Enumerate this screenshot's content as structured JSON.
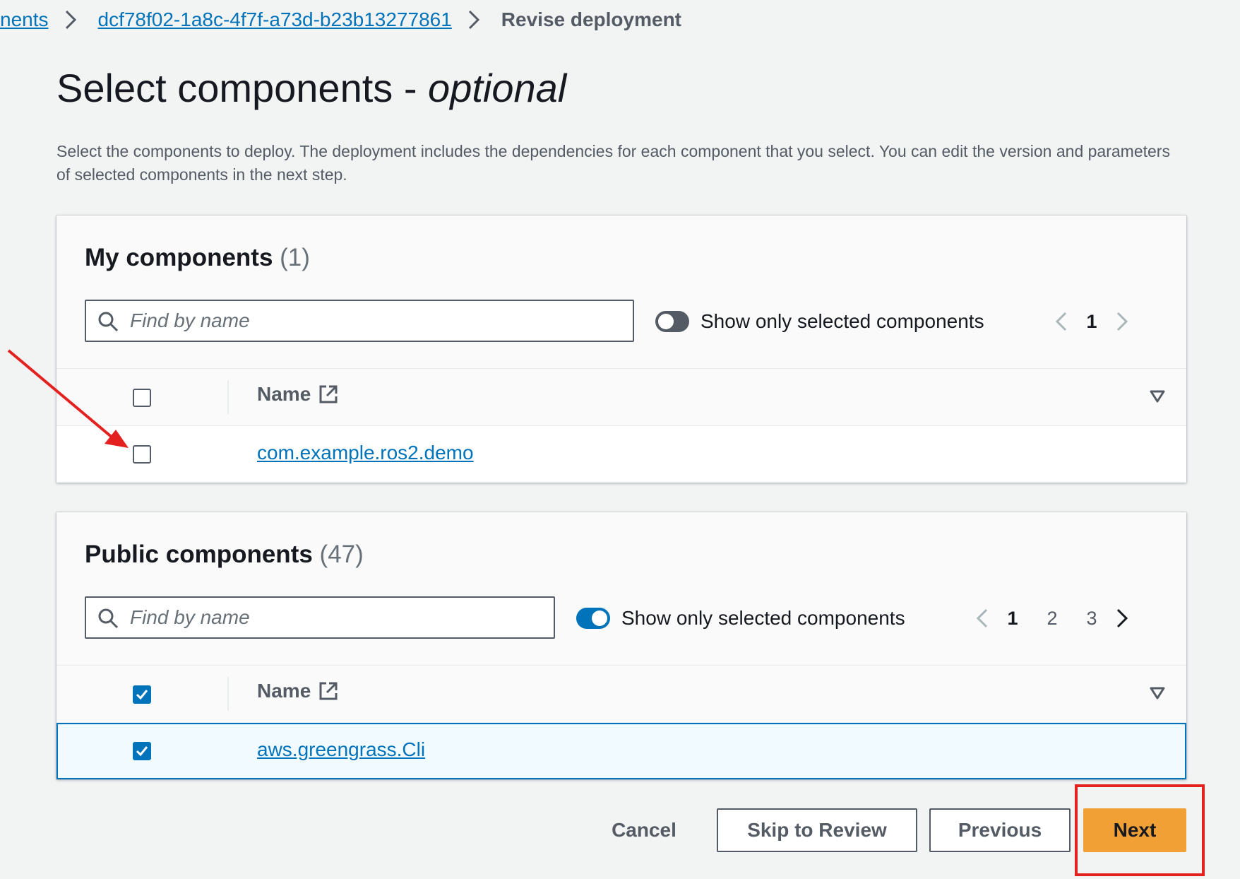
{
  "breadcrumb": {
    "items": [
      {
        "label": "nents"
      },
      {
        "label": "dcf78f02-1a8c-4f7f-a73d-b23b13277861"
      },
      {
        "label": "Revise deployment"
      }
    ]
  },
  "page": {
    "title": "Select components - ",
    "title_italic": "optional",
    "description": "Select the components to deploy. The deployment includes the dependencies for each component that you select. You can edit the version and parameters of selected components in the next step."
  },
  "my_components": {
    "title": "My components",
    "count": "(1)",
    "search_placeholder": "Find by name",
    "toggle_label": "Show only selected components",
    "toggle_on": false,
    "pages": [
      "1"
    ],
    "current_page": "1",
    "column_name": "Name",
    "rows": [
      {
        "name": "com.example.ros2.demo",
        "selected": false
      }
    ]
  },
  "public_components": {
    "title": "Public components",
    "count": "(47)",
    "search_placeholder": "Find by name",
    "toggle_label": "Show only selected components",
    "toggle_on": true,
    "pages": [
      "1",
      "2",
      "3"
    ],
    "current_page": "1",
    "column_name": "Name",
    "rows": [
      {
        "name": "aws.greengrass.Cli",
        "selected": true
      }
    ]
  },
  "footer": {
    "cancel": "Cancel",
    "skip": "Skip to Review",
    "previous": "Previous",
    "next": "Next"
  },
  "colors": {
    "link": "#0073bb",
    "primary_button": "#f0a035",
    "annotation": "#e3211f"
  },
  "icons": [
    "chevron-right-icon",
    "search-icon",
    "external-link-icon",
    "sort-caret-icon",
    "checkmark-icon",
    "chevron-left-icon"
  ]
}
